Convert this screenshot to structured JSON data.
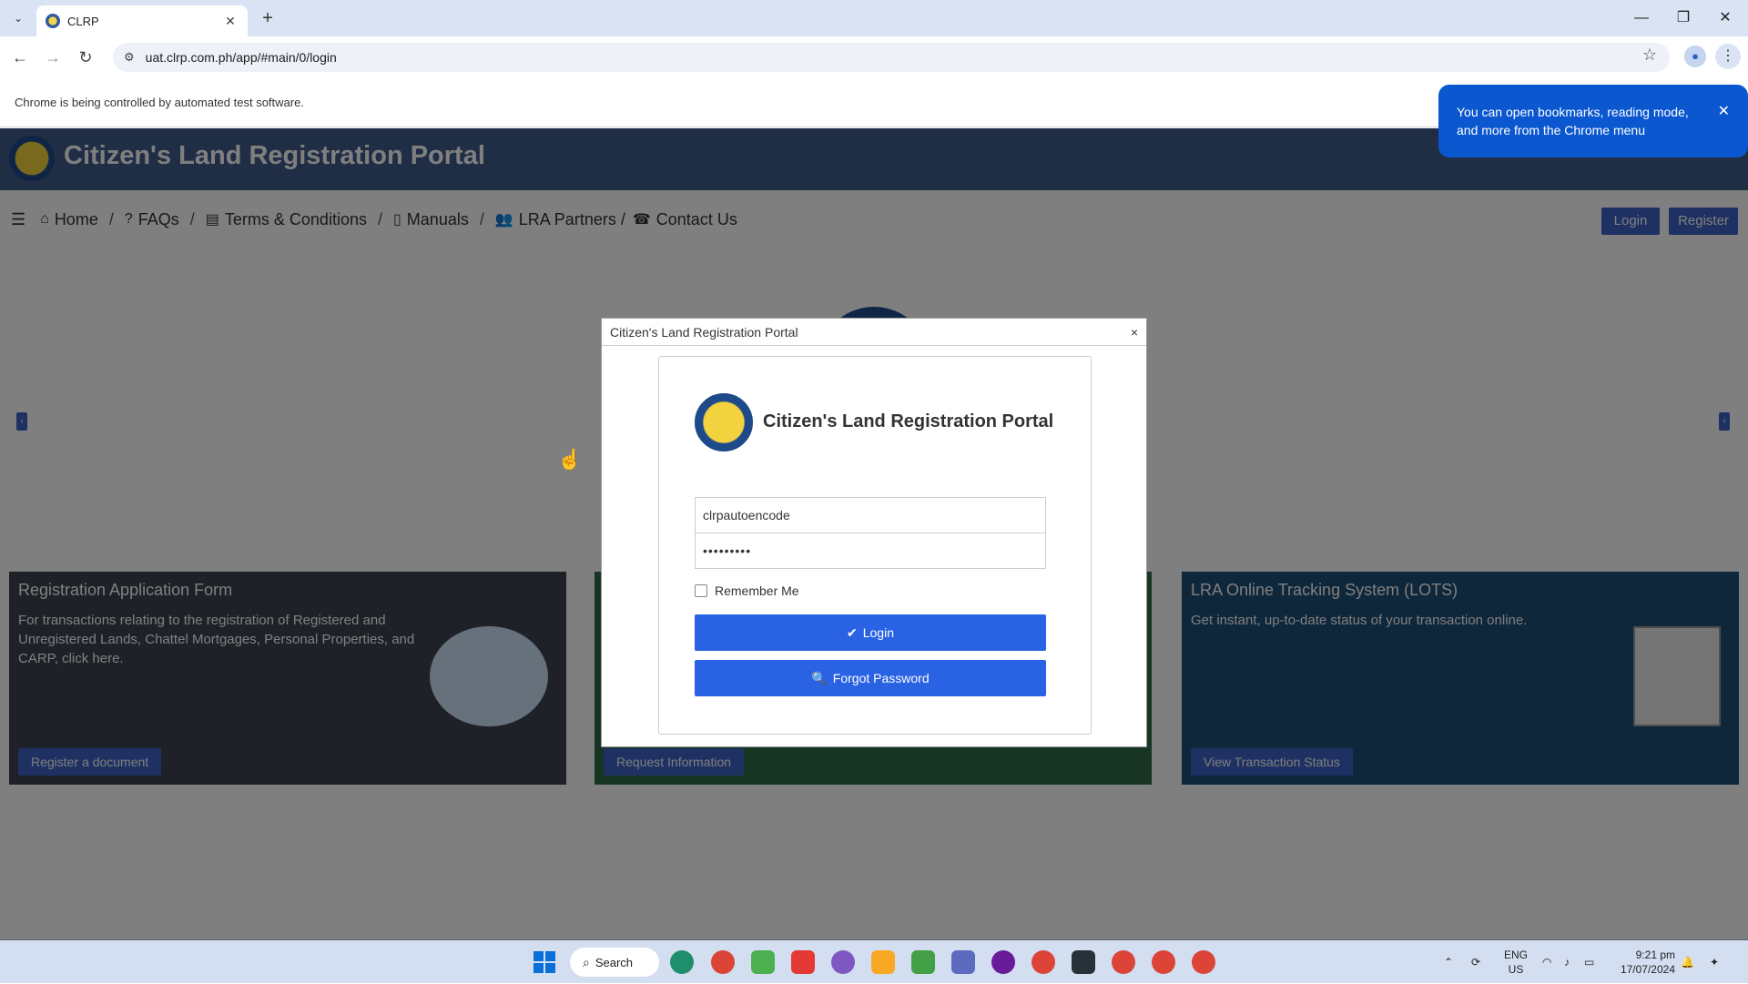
{
  "browser": {
    "tab_title": "CLRP",
    "url": "uat.clrp.com.ph/app/#main/0/login",
    "infobar_text": "Chrome is being controlled by automated test software.",
    "tip_text": "You can open bookmarks, reading mode, and more from the Chrome menu"
  },
  "site": {
    "title": "Citizen's Land Registration Portal",
    "nav": [
      {
        "label": "Home",
        "icon": "home-icon"
      },
      {
        "label": "FAQs",
        "icon": "question-icon"
      },
      {
        "label": "Terms & Conditions",
        "icon": "document-icon"
      },
      {
        "label": "Manuals",
        "icon": "manual-icon"
      },
      {
        "label": "LRA Partners /",
        "icon": "users-icon"
      },
      {
        "label": "Contact Us",
        "icon": "phone-icon"
      }
    ],
    "login_label": "Login",
    "register_label": "Register",
    "cards": [
      {
        "title": "Registration Application Form",
        "text": "For transactions relating to the registration of Registered and Unregistered Lands, Chattel Mortgages, Personal Properties, and CARP, click here.",
        "button": "Register a document",
        "color": "#3c4451"
      },
      {
        "title": "",
        "text": "",
        "button": "Request Information",
        "color": "#2f6a45"
      },
      {
        "title": "LRA Online Tracking System (LOTS)",
        "text": "Get instant, up-to-date status of your transaction online.",
        "button": "View Transaction Status",
        "color": "#1f4e75"
      }
    ]
  },
  "modal": {
    "header_title": "Citizen's Land Registration Portal",
    "close_symbol": "×",
    "title": "Citizen's Land Registration Portal",
    "username_value": "clrpautoencode",
    "password_value": "•••••••••",
    "remember_label": "Remember Me",
    "login_button": "Login",
    "forgot_button": "Forgot Password"
  },
  "taskbar": {
    "search_label": "Search",
    "lang_line1": "ENG",
    "lang_line2": "US",
    "time": "9:21 pm",
    "date": "17/07/2024"
  }
}
